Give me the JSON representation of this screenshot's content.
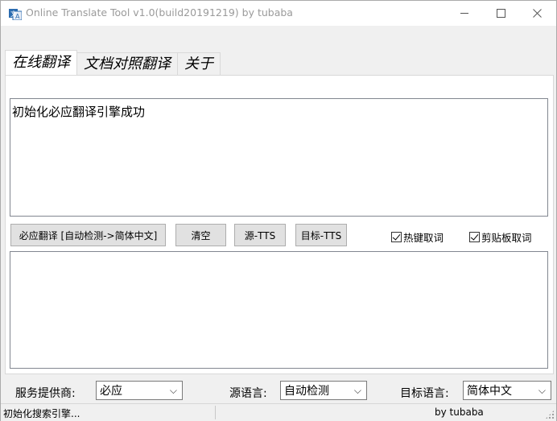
{
  "window": {
    "title": "Online Translate Tool v1.0(build20191219) by tubaba",
    "minimize_icon": "minimize-icon",
    "maximize_icon": "maximize-icon",
    "close_icon": "close-icon"
  },
  "tabs": [
    {
      "label": "在线翻译",
      "active": true
    },
    {
      "label": "文档对照翻译",
      "active": false
    },
    {
      "label": "关于",
      "active": false
    }
  ],
  "source_text": "初始化必应翻译引擎成功",
  "target_text": "",
  "buttons": {
    "translate": "必应翻译 [自动检测->简体中文]",
    "clear": "清空",
    "source_tts": "源-TTS",
    "target_tts": "目标-TTS"
  },
  "checkboxes": {
    "hotkey": {
      "label": "热键取词",
      "checked": true
    },
    "clipboard": {
      "label": "剪贴板取词",
      "checked": true
    }
  },
  "settings": {
    "provider_label": "服务提供商:",
    "provider_value": "必应",
    "source_label": "源语言:",
    "source_value": "自动检测",
    "target_label": "目标语言:",
    "target_value": "简体中文"
  },
  "status": {
    "left": "初始化搜索引擎...",
    "right": "by tubaba"
  },
  "colors": {
    "window_bg": "#f0f0f0",
    "button_bg": "#e1e1e1",
    "title_text": "#9a9a9a"
  }
}
